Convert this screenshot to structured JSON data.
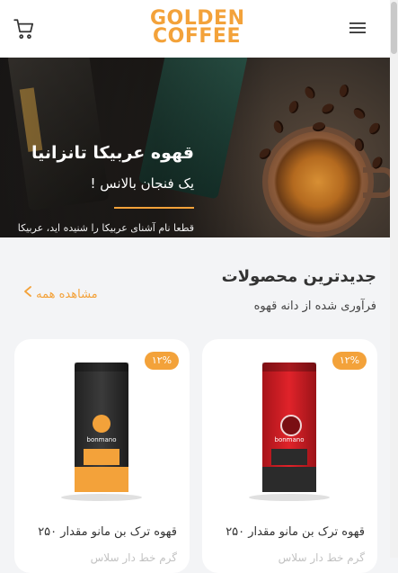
{
  "header": {
    "logo_line1": "GOLDEN",
    "logo_line2": "COFFEE",
    "cart_icon": "cart-icon",
    "menu_icon": "hamburger-menu-icon",
    "accent_color": "#f3a23a"
  },
  "banner": {
    "title": "قهوه عربیکا تانزانیا",
    "subtitle": "یک فنجان بالانس !",
    "description": "قطعا نام آشنای عربیکا را شنیده اید، عربیکا یکی از گونه های قهوه است که در نواحی مختلف کمربند قهوه کشت میشود."
  },
  "section": {
    "title": "جدیدترین محصولات",
    "subtitle": "فرآوری شده از دانه قهوه",
    "view_all": "مشاهده همه",
    "view_all_icon": "chevron-left-icon"
  },
  "products": [
    {
      "discount": "۱۲%",
      "brand": "bonmano",
      "name": "قهوه ترک بن مانو مقدار ۲۵۰",
      "name_cont": "گرم خط دار سلاس"
    },
    {
      "discount": "۱۲%",
      "brand": "bonmano",
      "name": "قهوه ترک بن مانو مقدار ۲۵۰",
      "name_cont": "گرم خط دار سلاس"
    }
  ]
}
